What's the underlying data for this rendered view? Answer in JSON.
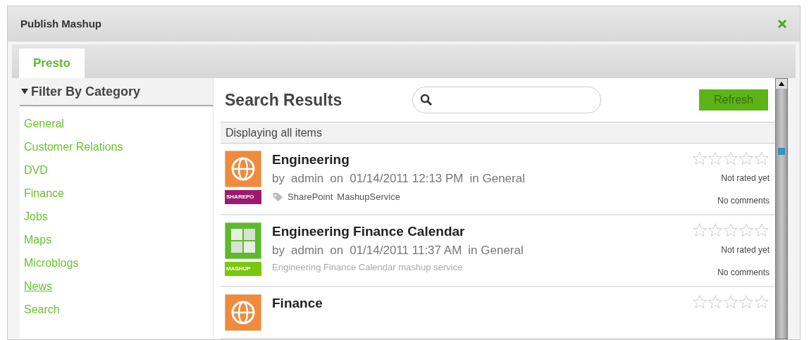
{
  "window": {
    "title": "Publish Mashup"
  },
  "tabs": [
    {
      "label": "Presto",
      "selected": true
    }
  ],
  "sidebar": {
    "title": "Filter By Category",
    "expanded": true,
    "items": [
      {
        "label": "General",
        "hovered": false
      },
      {
        "label": "Customer Relations",
        "hovered": false
      },
      {
        "label": "DVD",
        "hovered": false
      },
      {
        "label": "Finance",
        "hovered": false
      },
      {
        "label": "Jobs",
        "hovered": false
      },
      {
        "label": "Maps",
        "hovered": false
      },
      {
        "label": "Microblogs",
        "hovered": false
      },
      {
        "label": "News",
        "hovered": true
      },
      {
        "label": "Search",
        "hovered": false
      }
    ]
  },
  "results": {
    "title": "Search Results",
    "refresh_button": "Refresh",
    "status": "Displaying all items",
    "items": [
      {
        "kind": "sharepoint",
        "badge": "SHAREPO",
        "title": "Engineering",
        "by": "by",
        "author": "admin",
        "on": "on",
        "date": "01/14/2011 12:13 PM",
        "in": "in General",
        "tags": [
          "SharePoint",
          "MashupService"
        ],
        "stars": 0,
        "rating": "Not rated yet",
        "comments": "No comments"
      },
      {
        "kind": "mashup",
        "badge": "MASHUP",
        "title": "Engineering Finance Calendar",
        "by": "by",
        "author": "admin",
        "on": "on",
        "date": "01/14/2011 11:37 AM",
        "in": "in General",
        "description": "Engineering Finance Calendar mashup service",
        "stars": 0,
        "rating": "Not rated yet",
        "comments": "No comments"
      },
      {
        "kind": "sharepoint",
        "title": "Finance",
        "stars": 0
      }
    ]
  }
}
